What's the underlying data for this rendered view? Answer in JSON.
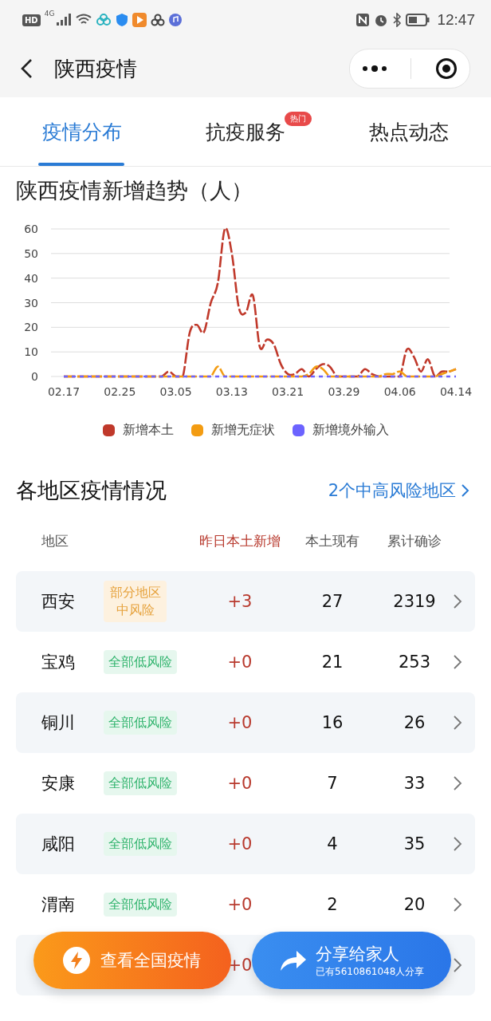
{
  "status_bar": {
    "hd": "HD",
    "network": "4G",
    "time": "12:47"
  },
  "nav": {
    "title": "陕西疫情"
  },
  "tabs": [
    {
      "label": "疫情分布",
      "selected": true
    },
    {
      "label": "抗疫服务",
      "selected": false,
      "badge": "热门"
    },
    {
      "label": "热点动态",
      "selected": false
    }
  ],
  "trend": {
    "title": "陕西疫情新增趋势（人）",
    "chart_data": {
      "type": "line",
      "categories": [
        "02.17",
        null,
        null,
        null,
        null,
        null,
        null,
        null,
        "02.25",
        null,
        null,
        null,
        null,
        null,
        null,
        null,
        "03.05",
        null,
        null,
        null,
        null,
        null,
        null,
        null,
        "03.13",
        null,
        null,
        null,
        null,
        null,
        null,
        null,
        "03.21",
        null,
        null,
        null,
        null,
        null,
        null,
        null,
        "03.29",
        null,
        null,
        null,
        null,
        null,
        null,
        null,
        "04.06",
        null,
        null,
        null,
        null,
        null,
        null,
        null,
        "04.14"
      ],
      "series": [
        {
          "name": "新增本土",
          "color": "#c0392b",
          "line_style": "dashed",
          "values": [
            0,
            0,
            0,
            0,
            0,
            0,
            0,
            0,
            0,
            0,
            0,
            0,
            0,
            0,
            0,
            2,
            0,
            0,
            18,
            21,
            18,
            30,
            38,
            60,
            50,
            28,
            26,
            33,
            12,
            15,
            13,
            5,
            1,
            1,
            3,
            0,
            3,
            5,
            4,
            0,
            0,
            0,
            0,
            3,
            1,
            0,
            0,
            0,
            0,
            11,
            8,
            2,
            7,
            0,
            2,
            2,
            3
          ]
        },
        {
          "name": "新增无症状",
          "color": "#f39c12",
          "line_style": "dashed",
          "values": [
            0,
            0,
            0,
            0,
            0,
            0,
            0,
            0,
            0,
            0,
            0,
            0,
            0,
            0,
            0,
            0,
            0,
            0,
            0,
            0,
            0,
            0,
            4,
            0,
            0,
            0,
            0,
            0,
            0,
            0,
            0,
            0,
            0,
            0,
            0,
            1,
            4,
            3,
            0,
            0,
            0,
            0,
            0,
            0,
            0,
            0,
            1,
            1,
            2,
            0,
            0,
            0,
            0,
            0,
            1,
            2,
            3
          ]
        },
        {
          "name": "新增境外输入",
          "color": "#6c63ff",
          "line_style": "dotted",
          "values": [
            0,
            0,
            0,
            0,
            0,
            0,
            0,
            0,
            0,
            0,
            0,
            0,
            0,
            0,
            0,
            0,
            0,
            0,
            0,
            0,
            0,
            0,
            0,
            0,
            0,
            0,
            0,
            0,
            0,
            0,
            0,
            0,
            0,
            0,
            0,
            0,
            0,
            0,
            0,
            0,
            0,
            0,
            0,
            0,
            0,
            0,
            0,
            0,
            0,
            0,
            0,
            0,
            0,
            0,
            0,
            0,
            0
          ]
        }
      ],
      "ylim": [
        0,
        60
      ],
      "grid": true,
      "yticks": [
        0,
        10,
        20,
        30,
        40,
        50,
        60
      ]
    }
  },
  "regions": {
    "title": "各地区疫情情况",
    "risk_link": "2个中高风险地区",
    "columns": [
      "地区",
      "昨日本土新增",
      "本土现有",
      "累计确诊"
    ],
    "rows": [
      {
        "name": "西安",
        "risk": "部分地区中风险",
        "kind": "medium",
        "change": "+3",
        "current": "27",
        "total": "2319"
      },
      {
        "name": "宝鸡",
        "risk": "全部低风险",
        "kind": "low",
        "change": "+0",
        "current": "21",
        "total": "253"
      },
      {
        "name": "铜川",
        "risk": "全部低风险",
        "kind": "low",
        "change": "+0",
        "current": "16",
        "total": "26"
      },
      {
        "name": "安康",
        "risk": "全部低风险",
        "kind": "low",
        "change": "+0",
        "current": "7",
        "total": "33"
      },
      {
        "name": "咸阳",
        "risk": "全部低风险",
        "kind": "low",
        "change": "+0",
        "current": "4",
        "total": "35"
      },
      {
        "name": "渭南",
        "risk": "全部低风险",
        "kind": "low",
        "change": "+0",
        "current": "2",
        "total": "20"
      },
      {
        "change": "+0"
      }
    ]
  },
  "actions": {
    "national": "查看全国疫情",
    "share": "分享给家人",
    "share_count": "已有5610861048人分享"
  }
}
